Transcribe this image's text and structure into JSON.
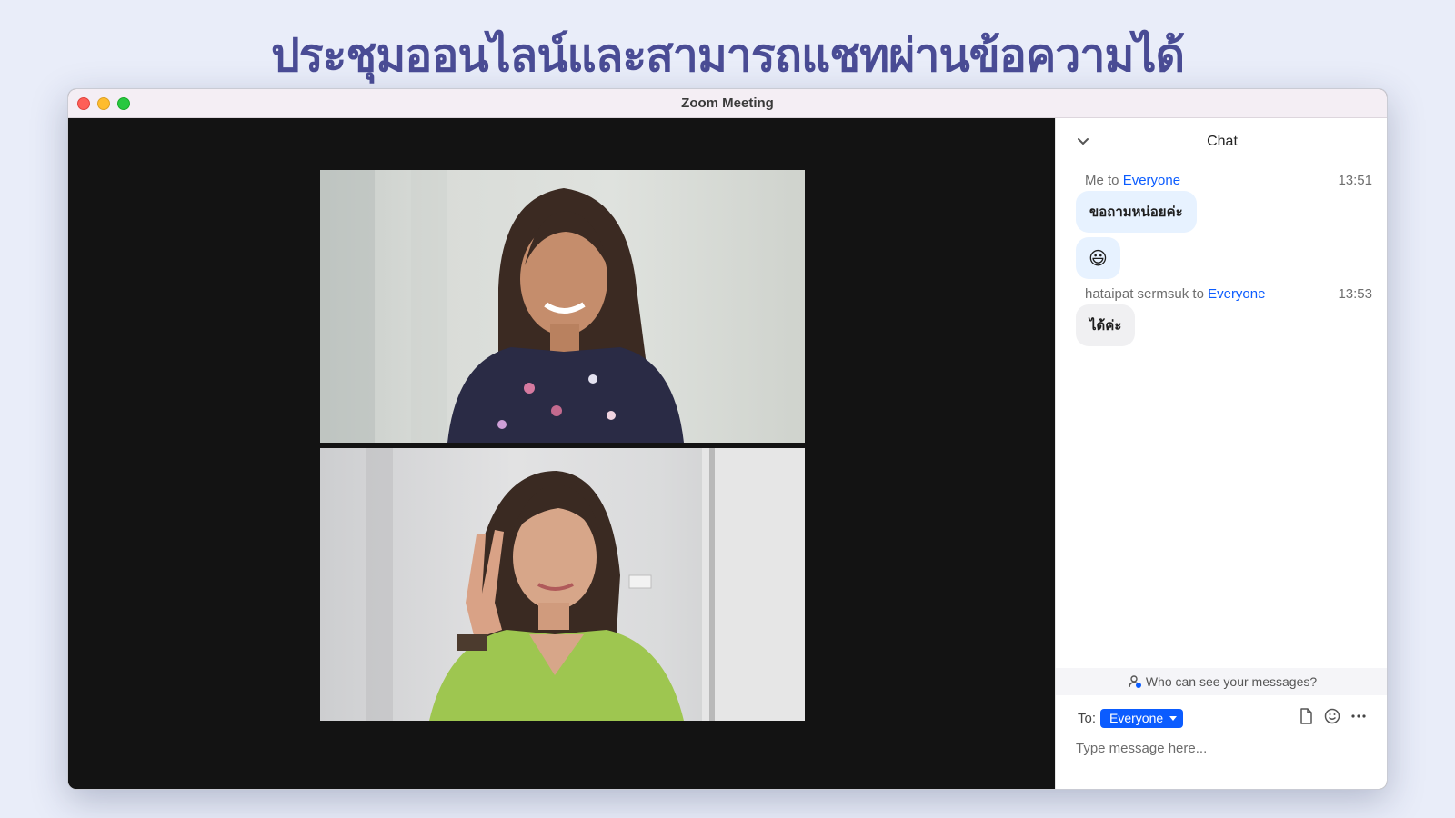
{
  "page": {
    "headline": "ประชุมออนไลน์และสามารถแชทผ่านข้อความได้"
  },
  "window": {
    "title": "Zoom Meeting"
  },
  "chat": {
    "title": "Chat",
    "messages": [
      {
        "sender": "Me",
        "connector": " to ",
        "recipient": "Everyone",
        "time": "13:51",
        "bubbles": [
          "ขอถามหน่อยค่ะ",
          "😃"
        ]
      },
      {
        "sender": "hataipat sermsuk",
        "connector": " to ",
        "recipient": "Everyone",
        "time": "13:53",
        "bubbles": [
          "ได้ค่ะ"
        ]
      }
    ],
    "privacy_text": "Who can see your messages?",
    "compose": {
      "to_label": "To:",
      "recipient": "Everyone",
      "placeholder": "Type message here..."
    }
  },
  "colors": {
    "headline": "#4a4c95",
    "accent": "#0b5cff",
    "video_bg": "#131313",
    "my_bubble": "#e7f2ff",
    "their_bubble": "#f0f0f2"
  },
  "icons": {
    "collapse": "chevron-down-icon",
    "privacy": "person-icon",
    "file": "file-icon",
    "emoji": "smiley-icon",
    "more": "more-icon"
  }
}
